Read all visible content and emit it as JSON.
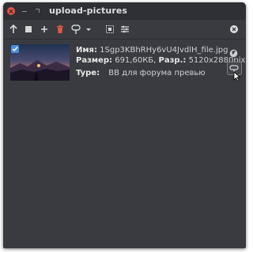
{
  "window": {
    "title": "upload-pictures"
  },
  "toolbar": {
    "buttons": [
      {
        "name": "upload",
        "icon": "arrow-up-icon"
      },
      {
        "name": "stop",
        "icon": "stop-icon"
      },
      {
        "name": "add",
        "icon": "plus-icon"
      },
      {
        "name": "delete",
        "icon": "trash-icon",
        "color": "#e05a4a"
      },
      {
        "name": "template",
        "icon": "link-template-icon"
      },
      {
        "name": "template-menu",
        "icon": "chevron-down-icon"
      },
      {
        "name": "select-all",
        "icon": "select-all-icon"
      },
      {
        "name": "settings",
        "icon": "sliders-icon"
      },
      {
        "name": "close",
        "icon": "close-circle-icon"
      }
    ]
  },
  "items": [
    {
      "checked": true,
      "name_label": "Имя:",
      "name_value": "1Sgp3KBhRHy6vU4JvdlH_file.jpg",
      "size_label": "Размер:",
      "size_value": "691,60КБ,",
      "resolution_label": "Разр.:",
      "resolution_value": "5120x2880pix",
      "type_label": "Type:",
      "type_value": "BB для форума превью"
    }
  ],
  "colors": {
    "window_bg": "#3a3b41",
    "titlebar_bg": "#2f3035",
    "checkbox": "#4c8fdd",
    "close_button": "#e3564b"
  }
}
